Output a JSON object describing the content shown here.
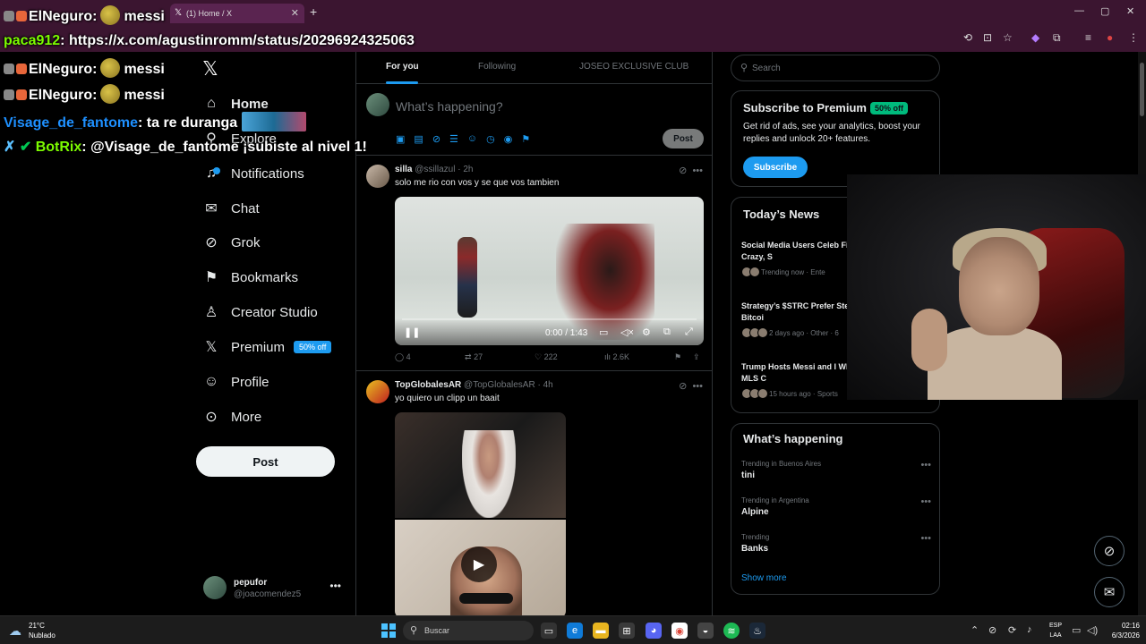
{
  "browser": {
    "tab_title": "(1) Home / X",
    "new_tab_icon": "+",
    "url": "https://x.com/agustinromm/status/2029692432506​3",
    "window_controls": [
      "—",
      "▢",
      "✕"
    ]
  },
  "chat": {
    "lines": [
      {
        "user": "ElNeguro",
        "color": "#ffffff",
        "message": "messi",
        "emote": true
      },
      {
        "user": "paca912",
        "color": "#7cfc00",
        "message": "https://x.com/agustinromm/status/2029692432506​3"
      },
      {
        "user": "ElNeguro",
        "color": "#ffffff",
        "message": "messi",
        "emote": true
      },
      {
        "user": "ElNeguro",
        "color": "#ffffff",
        "message": "messi",
        "emote": true
      },
      {
        "user": "Visage_de_fantome",
        "color": "#1e90ff",
        "message": "ta re duranga"
      },
      {
        "user": "BotRix",
        "color": "#7cfc00",
        "message": "@Visage_de_fantome ¡subiste al nivel 1!"
      }
    ]
  },
  "nav": {
    "items": [
      {
        "label": "Home",
        "icon": "home-icon",
        "glyph": "⌂"
      },
      {
        "label": "Explore",
        "icon": "search-icon",
        "glyph": "⚲"
      },
      {
        "label": "Notifications",
        "icon": "bell-icon",
        "glyph": "🔔"
      },
      {
        "label": "Chat",
        "icon": "mail-icon",
        "glyph": "✉"
      },
      {
        "label": "Grok",
        "icon": "grok-icon",
        "glyph": "⊘"
      },
      {
        "label": "Bookmarks",
        "icon": "bookmark-icon",
        "glyph": "⚑"
      },
      {
        "label": "Creator Studio",
        "icon": "creator-icon",
        "glyph": "♙"
      },
      {
        "label": "Premium",
        "icon": "x-logo-icon",
        "glyph": "𝕏",
        "badge": "50% off"
      },
      {
        "label": "Profile",
        "icon": "person-icon",
        "glyph": "☺"
      },
      {
        "label": "More",
        "icon": "more-circle-icon",
        "glyph": "⊙"
      }
    ],
    "notification_count": "1",
    "post_label": "Post",
    "user": {
      "name": "pepufor",
      "handle": "@joacomendez5"
    }
  },
  "feed": {
    "tabs": [
      "For you",
      "Following",
      "JOSEO EXCLUSIVE CLUB"
    ],
    "compose_placeholder": "What’s happening?",
    "compose_post": "Post",
    "tweets": [
      {
        "name": "silla",
        "handle": "@ssillazul",
        "time": "2h",
        "text": "solo me rio con vos y se que vos tambien",
        "video_time": "0:00 / 1:43",
        "replies": "4",
        "reposts": "27",
        "likes": "222",
        "views": "2.6K"
      },
      {
        "name": "TopGlobalesAR",
        "handle": "@TopGlobalesAR",
        "time": "4h",
        "text": "yo quiero un clipp un baait"
      }
    ]
  },
  "right": {
    "search_placeholder": "Search",
    "premium": {
      "title": "Subscribe to Premium",
      "badge": "50% off",
      "desc": "Get rid of ads, see your analytics, boost your replies and unlock 20+ features.",
      "button": "Subscribe"
    },
    "news": {
      "title": "Today’s News",
      "items": [
        {
          "title": "Social Media Users Celeb Fight Scene from Crazy, S",
          "meta": "Trending now · Ente"
        },
        {
          "title": "Strategy’s $STRC Prefer Steady Yield Amid Bitcoi",
          "meta": "2 days ago · Other · 6"
        },
        {
          "title": "Trump Hosts Messi and I White House After MLS C",
          "meta": "15 hours ago · Sports"
        }
      ]
    },
    "happening": {
      "title": "What’s happening",
      "trends": [
        {
          "context": "Trending in Buenos Aires",
          "name": "tini"
        },
        {
          "context": "Trending in Argentina",
          "name": "Alpine"
        },
        {
          "context": "Trending",
          "name": "Banks"
        }
      ],
      "show_more": "Show more"
    }
  },
  "taskbar": {
    "weather_temp": "21°C",
    "weather_desc": "Nublado",
    "search_placeholder": "Buscar",
    "lang_top": "ESP",
    "lang_bottom": "LAA",
    "time": "02:16",
    "date": "6/3/2026"
  },
  "colors": {
    "accent": "#1d9bf0",
    "premium_green": "#00ba7c",
    "chrome": "#3b1530"
  }
}
